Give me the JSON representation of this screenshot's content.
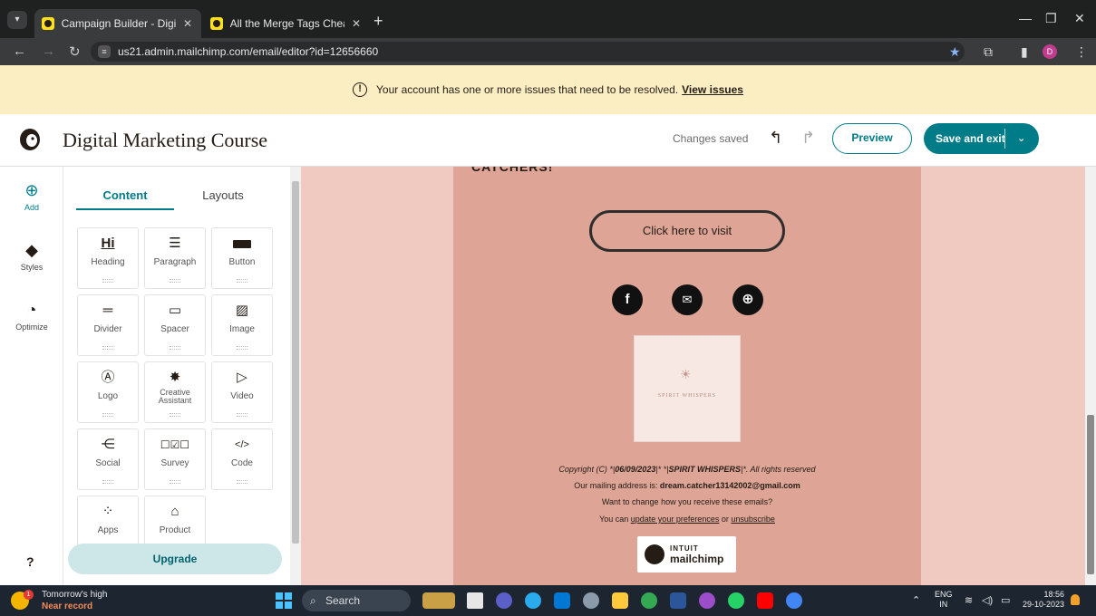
{
  "browser": {
    "tabs": [
      {
        "title": "Campaign Builder - Digital Ma",
        "active": true
      },
      {
        "title": "All the Merge Tags Cheat Shee",
        "active": false
      }
    ],
    "new_tab": "+",
    "url": "us21.admin.mailchimp.com/email/editor?id=12656660",
    "profile_initial": "D"
  },
  "banner": {
    "message": "Your account has one or more issues that need to be resolved.",
    "link": "View issues"
  },
  "header": {
    "title": "Digital Marketing Course",
    "status": "Changes saved",
    "preview": "Preview",
    "save_exit": "Save and exit"
  },
  "rail": {
    "add": "Add",
    "styles": "Styles",
    "optimize": "Optimize",
    "help": "?"
  },
  "panel": {
    "tabs": [
      "Content",
      "Layouts"
    ],
    "blocks": [
      {
        "label": "Heading",
        "icon": "heading-icon"
      },
      {
        "label": "Paragraph",
        "icon": "paragraph-icon"
      },
      {
        "label": "Button",
        "icon": "button-icon"
      },
      {
        "label": "Divider",
        "icon": "divider-icon"
      },
      {
        "label": "Spacer",
        "icon": "spacer-icon"
      },
      {
        "label": "Image",
        "icon": "image-icon"
      },
      {
        "label": "Logo",
        "icon": "logo-icon"
      },
      {
        "label": "Creative Assistant",
        "icon": "magic-wand-icon"
      },
      {
        "label": "Video",
        "icon": "video-icon"
      },
      {
        "label": "Social",
        "icon": "share-icon"
      },
      {
        "label": "Survey",
        "icon": "survey-icon"
      },
      {
        "label": "Code",
        "icon": "code-icon"
      },
      {
        "label": "Apps",
        "icon": "apps-icon"
      },
      {
        "label": "Product",
        "icon": "shopping-bag-icon"
      }
    ],
    "heading_glyph": "Hi",
    "upgrade": "Upgrade"
  },
  "email": {
    "cropped_heading": "CATCHERS!",
    "cta": "Click here to visit",
    "logo_text": "SPIRIT WHISPERS",
    "footer": {
      "copyright_prefix": "Copyright (C) *|",
      "copyright_date": "06/09/2023",
      "copyright_mid": "|* *|",
      "copyright_org": "SPIRIT WHISPERS",
      "copyright_suffix": "|*. All rights reserved",
      "mailing_prefix": "Our mailing address is:",
      "mailing_email": "dream.catcher13142002@gmail.com",
      "change_line": "Want to change how you receive these emails?",
      "you_can": "You can",
      "update_link": "update your preferences",
      "or": "or",
      "unsub_link": "unsubscribe"
    },
    "badge_line1": "INTUIT",
    "badge_line2": "mailchimp"
  },
  "taskbar": {
    "weather_line1": "Tomorrow's high",
    "weather_line2": "Near record",
    "weather_badge": "1",
    "search": "Search",
    "lang_line1": "ENG",
    "lang_line2": "IN",
    "time": "18:56",
    "date": "29-10-2023"
  },
  "colors": {
    "accent": "#007c89",
    "banner": "#fbeec3",
    "canvas_bg": "#f0c9c1",
    "email_bg": "#dea597"
  }
}
